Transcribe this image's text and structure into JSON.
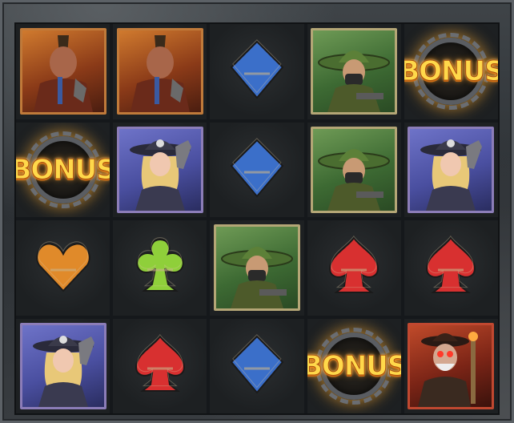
{
  "game": {
    "board": {
      "reels": 5,
      "rows": 4,
      "symbols": [
        [
          "mohawk-warrior",
          "mohawk-warrior",
          "blue-diamond",
          "masked-gunslinger",
          "bonus"
        ],
        [
          "bonus",
          "gunslinger-lady",
          "blue-diamond",
          "masked-gunslinger",
          "gunslinger-lady"
        ],
        [
          "orange-heart",
          "green-club",
          "masked-gunslinger",
          "red-spade",
          "red-spade"
        ],
        [
          "gunslinger-lady",
          "red-spade",
          "blue-diamond",
          "bonus",
          "goggled-elder"
        ]
      ]
    },
    "bonus_label": "BONUS",
    "colors": {
      "diamond": "#3b6fc9",
      "heart": "#e08a2a",
      "club": "#8fcf3a",
      "spade": "#d83030",
      "bonus_glow": "#ffb040"
    }
  }
}
